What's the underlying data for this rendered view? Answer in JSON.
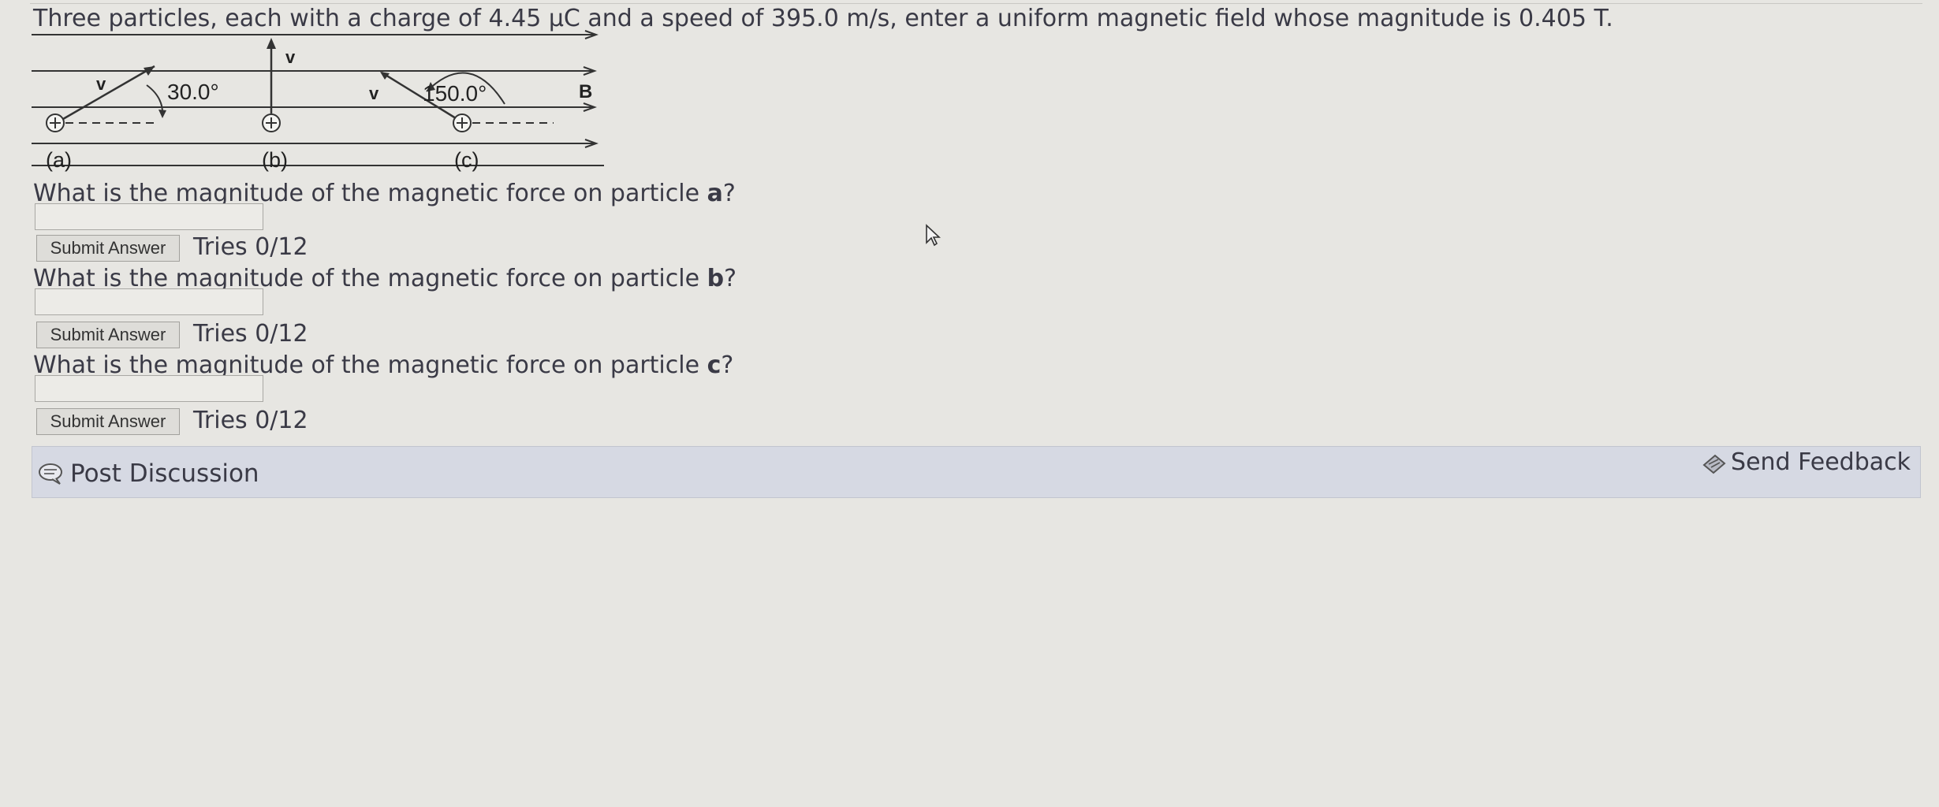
{
  "problem": {
    "statement": "Three particles, each with a charge of 4.45 μC and a speed of 395.0 m/s, enter a uniform magnetic field whose magnitude is 0.405 T."
  },
  "diagram": {
    "angle_a": "30.0°",
    "angle_c": "150.0°",
    "velocity_label": "v",
    "field_label": "B",
    "charge_symbol": "+",
    "label_a": "(a)",
    "label_b": "(b)",
    "label_c": "(c)"
  },
  "questions": [
    {
      "text_before": "What is the magnitude of the magnetic force on particle ",
      "particle": "a",
      "text_after": "?",
      "input_value": "",
      "submit_label": "Submit Answer",
      "tries": "Tries 0/12"
    },
    {
      "text_before": "What is the magnitude of the magnetic force on particle ",
      "particle": "b",
      "text_after": "?",
      "input_value": "",
      "submit_label": "Submit Answer",
      "tries": "Tries 0/12"
    },
    {
      "text_before": "What is the magnitude of the magnetic force on particle ",
      "particle": "c",
      "text_after": "?",
      "input_value": "",
      "submit_label": "Submit Answer",
      "tries": "Tries 0/12"
    }
  ],
  "footer": {
    "post_discussion": "Post Discussion",
    "send_feedback": "Send Feedback"
  },
  "icons": {
    "discussion": "speech-bubble-icon",
    "feedback": "feedback-icon",
    "cursor": "mouse-cursor-icon"
  }
}
